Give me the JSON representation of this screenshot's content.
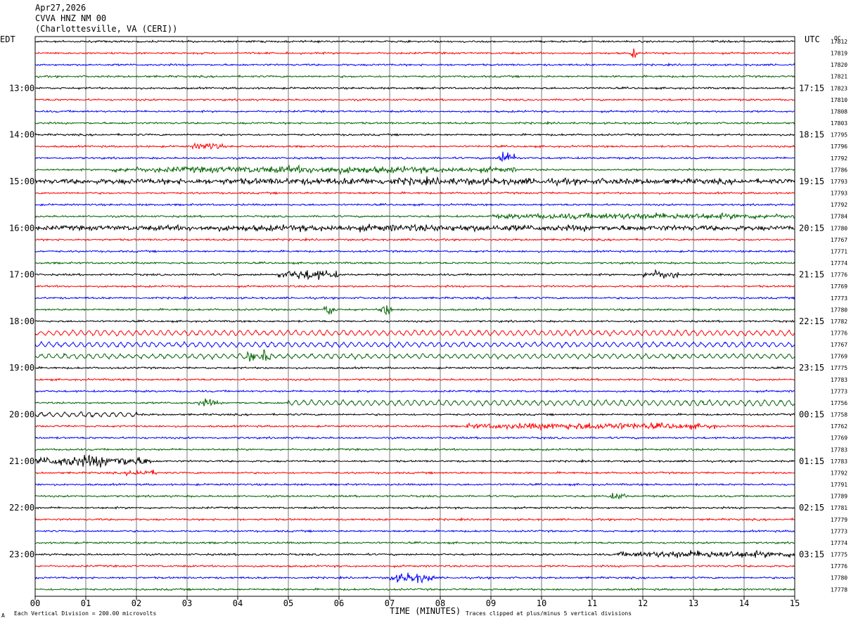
{
  "header": {
    "date": "Apr27,2026",
    "channel": "CVVA HNZ NM 00",
    "location": "(Charlottesville, VA (CERI))"
  },
  "left_timezone": "EDT",
  "right_timezone": "UTC",
  "qc_header": "QC",
  "footer": {
    "scale": "Each Vertical Division =  200.00 microvolts",
    "clip_note": "Traces clipped at plus/minus 5 vertical divisions",
    "corner_mark": "A"
  },
  "chart_data": {
    "type": "line",
    "xlabel": "TIME (MINUTES)",
    "xlim": [
      0,
      15
    ],
    "x_ticks": [
      "00",
      "01",
      "02",
      "03",
      "04",
      "05",
      "06",
      "07",
      "08",
      "09",
      "10",
      "11",
      "12",
      "13",
      "14",
      "15"
    ],
    "traces_per_hour": 4,
    "trace_colors": [
      "#000000",
      "#ff0000",
      "#0000ff",
      "#006400"
    ],
    "hour_labels_left": [
      "13:00",
      "14:00",
      "15:00",
      "16:00",
      "17:00",
      "18:00",
      "19:00",
      "20:00",
      "21:00",
      "22:00",
      "23:00"
    ],
    "hour_labels_right": [
      "17:15",
      "18:15",
      "19:15",
      "20:15",
      "21:15",
      "22:15",
      "23:15",
      "00:15",
      "01:15",
      "02:15",
      "03:15"
    ],
    "qc_values": [
      "17812",
      "17819",
      "17820",
      "17821",
      "17823",
      "17810",
      "17808",
      "17803",
      "17795",
      "17796",
      "17792",
      "17786",
      "17793",
      "17793",
      "17792",
      "17784",
      "17780",
      "17767",
      "17771",
      "17774",
      "17776",
      "17769",
      "17773",
      "17780",
      "17782",
      "17776",
      "17767",
      "17769",
      "17775",
      "17783",
      "17773",
      "17756",
      "17758",
      "17762",
      "17769",
      "17783",
      "17783",
      "17792",
      "17791",
      "17789",
      "17781",
      "17779",
      "17773",
      "17774",
      "17775",
      "17776",
      "17780",
      "17778"
    ],
    "events": [
      {
        "trace": 1,
        "start_min": 11.75,
        "end_min": 11.9,
        "amp": 3.0
      },
      {
        "trace": 9,
        "start_min": 3.1,
        "end_min": 3.7,
        "amp": 2.0
      },
      {
        "trace": 10,
        "start_min": 9.15,
        "end_min": 9.5,
        "amp": 5.0
      },
      {
        "trace": 11,
        "start_min": 1.5,
        "end_min": 9.5,
        "amp": 1.8
      },
      {
        "trace": 12,
        "start_min": 0.0,
        "end_min": 15.0,
        "amp": 1.7
      },
      {
        "trace": 15,
        "start_min": 9.0,
        "end_min": 15.0,
        "amp": 1.6
      },
      {
        "trace": 16,
        "start_min": 0.0,
        "end_min": 15.0,
        "amp": 1.6
      },
      {
        "trace": 20,
        "start_min": 4.8,
        "end_min": 6.0,
        "amp": 3.0
      },
      {
        "trace": 20,
        "start_min": 12.0,
        "end_min": 12.7,
        "amp": 2.6
      },
      {
        "trace": 23,
        "start_min": 5.7,
        "end_min": 5.95,
        "amp": 3.5
      },
      {
        "trace": 23,
        "start_min": 6.8,
        "end_min": 7.05,
        "amp": 4.0
      },
      {
        "trace": 27,
        "start_min": 4.15,
        "end_min": 4.35,
        "amp": 5.0
      },
      {
        "trace": 27,
        "start_min": 4.45,
        "end_min": 4.65,
        "amp": 4.0
      },
      {
        "trace": 31,
        "start_min": 3.2,
        "end_min": 3.6,
        "amp": 2.0
      },
      {
        "trace": 33,
        "start_min": 8.5,
        "end_min": 13.5,
        "amp": 1.8
      },
      {
        "trace": 36,
        "start_min": 0.0,
        "end_min": 2.3,
        "amp": 3.5
      },
      {
        "trace": 37,
        "start_min": 1.8,
        "end_min": 2.4,
        "amp": 1.6
      },
      {
        "trace": 39,
        "start_min": 11.3,
        "end_min": 11.7,
        "amp": 1.8
      },
      {
        "trace": 44,
        "start_min": 11.5,
        "end_min": 15.0,
        "amp": 2.0
      },
      {
        "trace": 46,
        "start_min": 7.0,
        "end_min": 7.9,
        "amp": 3.0
      }
    ],
    "long_period": [
      {
        "trace": 25,
        "start_min": 0.0,
        "end_min": 15.0,
        "amp": 1.4
      },
      {
        "trace": 26,
        "start_min": 0.0,
        "end_min": 15.0,
        "amp": 1.3
      },
      {
        "trace": 27,
        "start_min": 0.0,
        "end_min": 15.0,
        "amp": 1.2
      },
      {
        "trace": 31,
        "start_min": 5.0,
        "end_min": 15.0,
        "amp": 1.5
      },
      {
        "trace": 32,
        "start_min": 0.0,
        "end_min": 2.0,
        "amp": 1.2
      }
    ]
  }
}
